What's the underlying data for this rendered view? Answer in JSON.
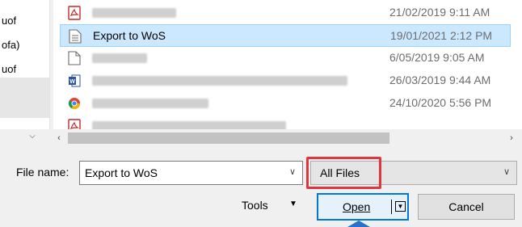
{
  "nav": {
    "items": [
      "uof",
      "ofa)",
      "uof"
    ]
  },
  "files": [
    {
      "icon": "pdf-icon",
      "name": "",
      "date": "21/02/2019 9:11 AM",
      "blur_width": 104,
      "selected": false
    },
    {
      "icon": "text-document-icon",
      "name": "Export to WoS",
      "date": "19/01/2021 2:12 PM",
      "selected": true
    },
    {
      "icon": "blank-document-icon",
      "name": "",
      "date": "6/05/2019 9:05 AM",
      "blur_width": 68,
      "selected": false
    },
    {
      "icon": "word-document-icon",
      "name": "",
      "date": "26/03/2019 9:44 AM",
      "blur_width": 316,
      "selected": false
    },
    {
      "icon": "chrome-icon",
      "name": "",
      "date": "24/10/2020 5:56 PM",
      "blur_width": 144,
      "selected": false
    },
    {
      "icon": "pdf-icon",
      "name": "",
      "date": "",
      "blur_width": 240,
      "selected": false
    }
  ],
  "filename": {
    "label": "File name:",
    "value": "Export to WoS"
  },
  "filetype": {
    "value": "All Files"
  },
  "buttons": {
    "tools": "Tools",
    "open": "Open",
    "cancel": "Cancel"
  },
  "colors": {
    "highlight": "#e0353f",
    "selection": "#cce8ff",
    "accent": "#0078d7"
  }
}
